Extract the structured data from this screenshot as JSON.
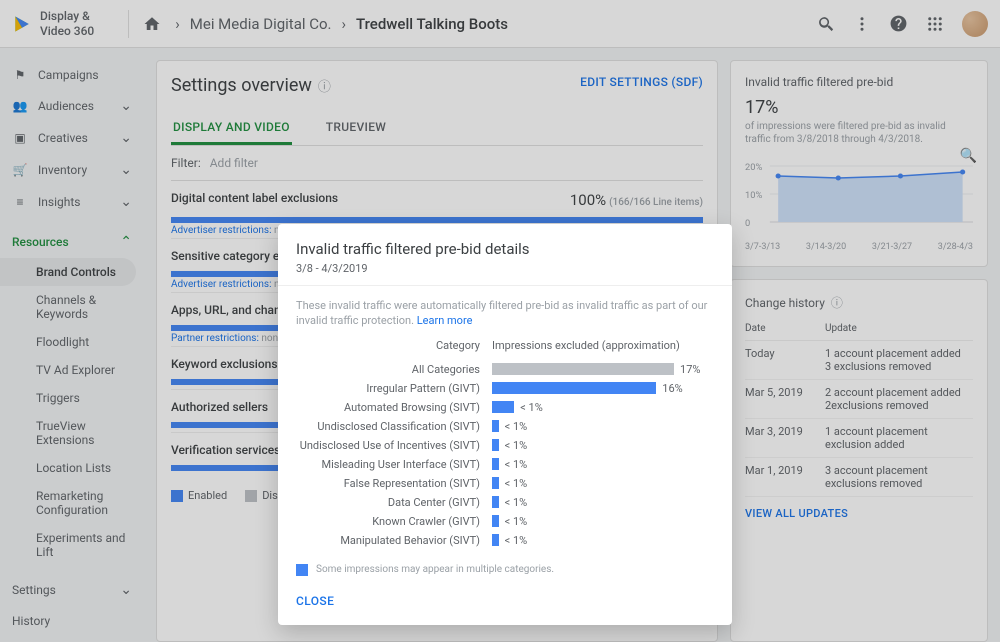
{
  "product_name": "Display &\nVideo 360",
  "breadcrumb": {
    "org": "Mei Media Digital Co.",
    "advertiser": "Tredwell Talking Boots"
  },
  "header": {
    "search_icon": "search",
    "more_icon": "more",
    "help_icon": "help",
    "apps_icon": "apps"
  },
  "sidebar": {
    "items": [
      {
        "label": "Campaigns",
        "icon": "flag"
      },
      {
        "label": "Audiences",
        "icon": "people",
        "chev": true
      },
      {
        "label": "Creatives",
        "icon": "image",
        "chev": true
      },
      {
        "label": "Inventory",
        "icon": "cart",
        "chev": true
      },
      {
        "label": "Insights",
        "icon": "insights",
        "chev": true
      }
    ],
    "resources_label": "Resources",
    "resources": [
      {
        "label": "Brand Controls",
        "active": true
      },
      {
        "label": "Channels & Keywords"
      },
      {
        "label": "Floodlight"
      },
      {
        "label": "TV Ad Explorer"
      },
      {
        "label": "Triggers"
      },
      {
        "label": "TrueView Extensions"
      },
      {
        "label": "Location Lists"
      },
      {
        "label": "Remarketing Configuration"
      },
      {
        "label": "Experiments and Lift"
      }
    ],
    "settings_label": "Settings",
    "history_label": "History"
  },
  "overview": {
    "title": "Settings overview",
    "edit_label": "EDIT SETTINGS (SDF)",
    "tabs": [
      "DISPLAY AND VIDEO",
      "TRUEVIEW"
    ],
    "filter_label": "Filter:",
    "filter_hint": "Add filter",
    "sections": [
      {
        "name": "Digital content label exclusions",
        "pct": "100%",
        "sub": "(166/166 Line items)",
        "restr": "Advertiser restrictions:",
        "restr_v": "n"
      },
      {
        "name": "Sensitive category exc",
        "restr": "Advertiser restrictions:",
        "restr_v": "n"
      },
      {
        "name": "Apps, URL, and chann",
        "restr": "Partner restrictions:",
        "restr_v": "non"
      },
      {
        "name": "Keyword exclusions"
      },
      {
        "name": "Authorized sellers"
      },
      {
        "name": "Verification services"
      }
    ],
    "legend": {
      "enabled": "Enabled",
      "disabled": "Disabl"
    }
  },
  "traffic_card": {
    "title": "Invalid traffic filtered pre-bid",
    "big": "17%",
    "caption": "of impressions were filtered pre-bid as invalid traffic from 3/8/2018 through 4/3/2018.",
    "y": [
      "20%",
      "10%",
      "0"
    ],
    "x": [
      "3/7-3/13",
      "3/14-3/20",
      "3/21-3/27",
      "3/28-4/3"
    ]
  },
  "change_history": {
    "title": "Change history",
    "cols": [
      "Date",
      "Update"
    ],
    "rows": [
      {
        "date": "Today",
        "update": "1 account placement added\n3 exclusions removed"
      },
      {
        "date": "Mar 5, 2019",
        "update": "2 account placement added\n 2exclusions removed"
      },
      {
        "date": "Mar 3, 2019",
        "update": "1 account placement exclusion added"
      },
      {
        "date": "Mar 1, 2019",
        "update": "3 account placement exclusions removed"
      }
    ],
    "view_all": "VIEW ALL UPDATES"
  },
  "modal": {
    "title": "Invalid traffic filtered pre-bid details",
    "range": "3/8 - 4/3/2019",
    "desc": "These invalid traffic were automatically filtered pre-bid as invalid traffic as part of our invalid traffic protection. ",
    "learn": "Learn more",
    "th": [
      "Category",
      "Impressions excluded (approximation)"
    ],
    "rows": [
      {
        "cat": "All Categories",
        "pct": "17%",
        "w": 82,
        "cls": "gray"
      },
      {
        "cat": "Irregular Pattern (GIVT)",
        "pct": "16%",
        "w": 74,
        "cls": "blue"
      },
      {
        "cat": "Automated Browsing (SIVT)",
        "pct": "< 1%",
        "w": 10,
        "cls": "blue"
      },
      {
        "cat": "Undisclosed Classification (SIVT)",
        "pct": "< 1%",
        "w": 3,
        "cls": "blue"
      },
      {
        "cat": "Undisclosed Use of Incentives (SIVT)",
        "pct": "< 1%",
        "w": 3,
        "cls": "blue"
      },
      {
        "cat": "Misleading User Interface (SIVT)",
        "pct": "< 1%",
        "w": 3,
        "cls": "blue"
      },
      {
        "cat": "False Representation (SIVT)",
        "pct": "< 1%",
        "w": 3,
        "cls": "blue"
      },
      {
        "cat": "Data Center (GIVT)",
        "pct": "< 1%",
        "w": 3,
        "cls": "blue"
      },
      {
        "cat": "Known Crawler (GIVT)",
        "pct": "< 1%",
        "w": 3,
        "cls": "blue"
      },
      {
        "cat": "Manipulated Behavior (SIVT)",
        "pct": "< 1%",
        "w": 3,
        "cls": "blue"
      }
    ],
    "note": "Some impressions may appear in multiple categories.",
    "close": "CLOSE"
  },
  "chart_data": {
    "type": "bar",
    "title": "Invalid traffic filtered pre-bid details — Impressions excluded (approximation)",
    "xlabel": "Category",
    "ylabel": "Impressions excluded %",
    "categories": [
      "All Categories",
      "Irregular Pattern (GIVT)",
      "Automated Browsing (SIVT)",
      "Undisclosed Classification (SIVT)",
      "Undisclosed Use of Incentives (SIVT)",
      "Misleading User Interface (SIVT)",
      "False Representation (SIVT)",
      "Data Center (GIVT)",
      "Known Crawler (GIVT)",
      "Manipulated Behavior (SIVT)"
    ],
    "values": [
      17,
      16,
      0.8,
      0.4,
      0.4,
      0.4,
      0.4,
      0.4,
      0.4,
      0.4
    ],
    "xlim": [
      0,
      20
    ]
  }
}
